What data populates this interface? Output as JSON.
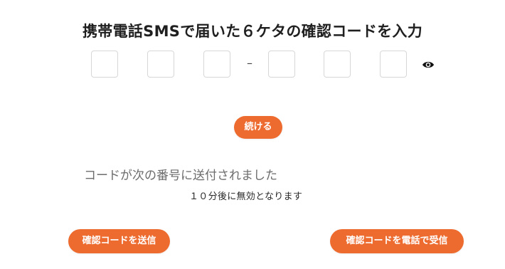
{
  "title": "携帯電話SMSで届いた６ケタの確認コードを入力",
  "code": {
    "values": [
      "",
      "",
      "",
      "",
      "",
      ""
    ],
    "separator": "–"
  },
  "icons": {
    "toggle_visibility": "eye-icon"
  },
  "buttons": {
    "continue": "続ける",
    "resend": "確認コードを送信",
    "phone": "確認コードを電話で受信"
  },
  "messages": {
    "sent": "コードが次の番号に送付されました",
    "expire": "１０分後に無効となります"
  },
  "colors": {
    "accent": "#ee6b2f",
    "box_border": "#d7d7d7",
    "muted_text": "#6c6c6c"
  }
}
